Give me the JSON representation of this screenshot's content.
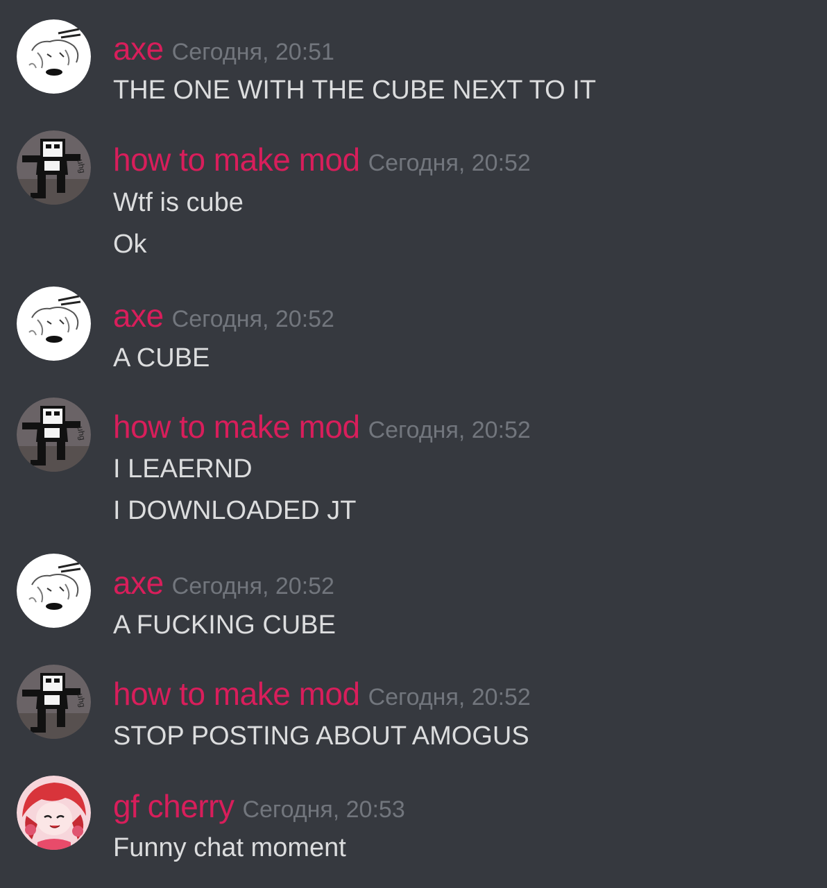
{
  "channel": {
    "messages": [
      {
        "author": "axe",
        "timestamp": "Сегодня, 20:51",
        "avatar_icon": "axe-avatar-icon",
        "lines": [
          "THE ONE WITH THE CUBE NEXT TO IT"
        ]
      },
      {
        "author": "how to make mod",
        "timestamp": "Сегодня, 20:52",
        "avatar_icon": "mod-avatar-icon",
        "lines": [
          "Wtf is cube",
          "Ok"
        ]
      },
      {
        "author": "axe",
        "timestamp": "Сегодня, 20:52",
        "avatar_icon": "axe-avatar-icon",
        "lines": [
          "A CUBE"
        ]
      },
      {
        "author": "how to make mod",
        "timestamp": "Сегодня, 20:52",
        "avatar_icon": "mod-avatar-icon",
        "lines": [
          "I LEAERND",
          "I DOWNLOADED JT"
        ]
      },
      {
        "author": "axe",
        "timestamp": "Сегодня, 20:52",
        "avatar_icon": "axe-avatar-icon",
        "lines": [
          "A FUCKING CUBE"
        ]
      },
      {
        "author": "how to make mod",
        "timestamp": "Сегодня, 20:52",
        "avatar_icon": "mod-avatar-icon",
        "lines": [
          "STOP POSTING ABOUT AMOGUS"
        ]
      },
      {
        "author": "gf cherry",
        "timestamp": "Сегодня, 20:53",
        "avatar_icon": "gf-cherry-avatar-icon",
        "lines": [
          "Funny chat moment"
        ]
      }
    ]
  },
  "colors": {
    "background": "#36393f",
    "username": "#d81e5b",
    "timestamp": "#72767d",
    "message_text": "#dcddde"
  }
}
